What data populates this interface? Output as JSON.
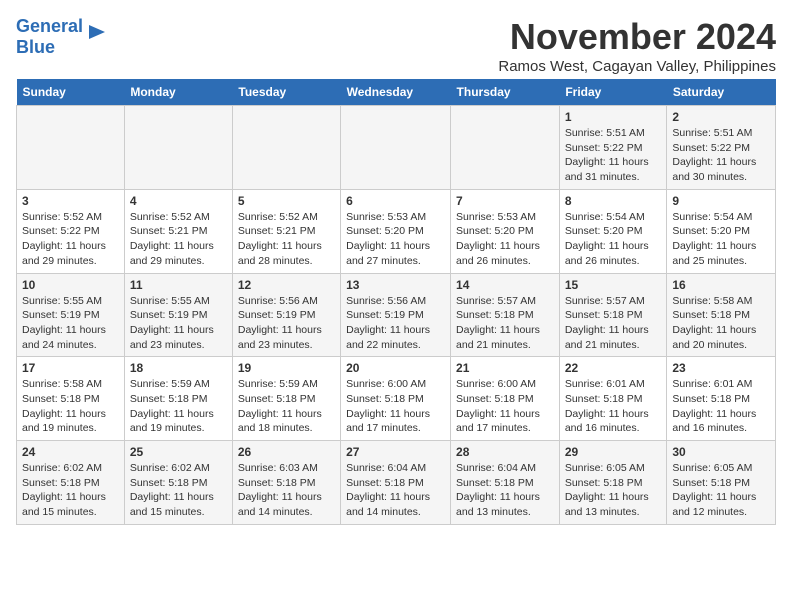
{
  "header": {
    "logo_line1": "General",
    "logo_line2": "Blue",
    "month": "November 2024",
    "location": "Ramos West, Cagayan Valley, Philippines"
  },
  "weekdays": [
    "Sunday",
    "Monday",
    "Tuesday",
    "Wednesday",
    "Thursday",
    "Friday",
    "Saturday"
  ],
  "weeks": [
    [
      {
        "day": "",
        "info": ""
      },
      {
        "day": "",
        "info": ""
      },
      {
        "day": "",
        "info": ""
      },
      {
        "day": "",
        "info": ""
      },
      {
        "day": "",
        "info": ""
      },
      {
        "day": "1",
        "info": "Sunrise: 5:51 AM\nSunset: 5:22 PM\nDaylight: 11 hours\nand 31 minutes."
      },
      {
        "day": "2",
        "info": "Sunrise: 5:51 AM\nSunset: 5:22 PM\nDaylight: 11 hours\nand 30 minutes."
      }
    ],
    [
      {
        "day": "3",
        "info": "Sunrise: 5:52 AM\nSunset: 5:22 PM\nDaylight: 11 hours\nand 29 minutes."
      },
      {
        "day": "4",
        "info": "Sunrise: 5:52 AM\nSunset: 5:21 PM\nDaylight: 11 hours\nand 29 minutes."
      },
      {
        "day": "5",
        "info": "Sunrise: 5:52 AM\nSunset: 5:21 PM\nDaylight: 11 hours\nand 28 minutes."
      },
      {
        "day": "6",
        "info": "Sunrise: 5:53 AM\nSunset: 5:20 PM\nDaylight: 11 hours\nand 27 minutes."
      },
      {
        "day": "7",
        "info": "Sunrise: 5:53 AM\nSunset: 5:20 PM\nDaylight: 11 hours\nand 26 minutes."
      },
      {
        "day": "8",
        "info": "Sunrise: 5:54 AM\nSunset: 5:20 PM\nDaylight: 11 hours\nand 26 minutes."
      },
      {
        "day": "9",
        "info": "Sunrise: 5:54 AM\nSunset: 5:20 PM\nDaylight: 11 hours\nand 25 minutes."
      }
    ],
    [
      {
        "day": "10",
        "info": "Sunrise: 5:55 AM\nSunset: 5:19 PM\nDaylight: 11 hours\nand 24 minutes."
      },
      {
        "day": "11",
        "info": "Sunrise: 5:55 AM\nSunset: 5:19 PM\nDaylight: 11 hours\nand 23 minutes."
      },
      {
        "day": "12",
        "info": "Sunrise: 5:56 AM\nSunset: 5:19 PM\nDaylight: 11 hours\nand 23 minutes."
      },
      {
        "day": "13",
        "info": "Sunrise: 5:56 AM\nSunset: 5:19 PM\nDaylight: 11 hours\nand 22 minutes."
      },
      {
        "day": "14",
        "info": "Sunrise: 5:57 AM\nSunset: 5:18 PM\nDaylight: 11 hours\nand 21 minutes."
      },
      {
        "day": "15",
        "info": "Sunrise: 5:57 AM\nSunset: 5:18 PM\nDaylight: 11 hours\nand 21 minutes."
      },
      {
        "day": "16",
        "info": "Sunrise: 5:58 AM\nSunset: 5:18 PM\nDaylight: 11 hours\nand 20 minutes."
      }
    ],
    [
      {
        "day": "17",
        "info": "Sunrise: 5:58 AM\nSunset: 5:18 PM\nDaylight: 11 hours\nand 19 minutes."
      },
      {
        "day": "18",
        "info": "Sunrise: 5:59 AM\nSunset: 5:18 PM\nDaylight: 11 hours\nand 19 minutes."
      },
      {
        "day": "19",
        "info": "Sunrise: 5:59 AM\nSunset: 5:18 PM\nDaylight: 11 hours\nand 18 minutes."
      },
      {
        "day": "20",
        "info": "Sunrise: 6:00 AM\nSunset: 5:18 PM\nDaylight: 11 hours\nand 17 minutes."
      },
      {
        "day": "21",
        "info": "Sunrise: 6:00 AM\nSunset: 5:18 PM\nDaylight: 11 hours\nand 17 minutes."
      },
      {
        "day": "22",
        "info": "Sunrise: 6:01 AM\nSunset: 5:18 PM\nDaylight: 11 hours\nand 16 minutes."
      },
      {
        "day": "23",
        "info": "Sunrise: 6:01 AM\nSunset: 5:18 PM\nDaylight: 11 hours\nand 16 minutes."
      }
    ],
    [
      {
        "day": "24",
        "info": "Sunrise: 6:02 AM\nSunset: 5:18 PM\nDaylight: 11 hours\nand 15 minutes."
      },
      {
        "day": "25",
        "info": "Sunrise: 6:02 AM\nSunset: 5:18 PM\nDaylight: 11 hours\nand 15 minutes."
      },
      {
        "day": "26",
        "info": "Sunrise: 6:03 AM\nSunset: 5:18 PM\nDaylight: 11 hours\nand 14 minutes."
      },
      {
        "day": "27",
        "info": "Sunrise: 6:04 AM\nSunset: 5:18 PM\nDaylight: 11 hours\nand 14 minutes."
      },
      {
        "day": "28",
        "info": "Sunrise: 6:04 AM\nSunset: 5:18 PM\nDaylight: 11 hours\nand 13 minutes."
      },
      {
        "day": "29",
        "info": "Sunrise: 6:05 AM\nSunset: 5:18 PM\nDaylight: 11 hours\nand 13 minutes."
      },
      {
        "day": "30",
        "info": "Sunrise: 6:05 AM\nSunset: 5:18 PM\nDaylight: 11 hours\nand 12 minutes."
      }
    ]
  ]
}
